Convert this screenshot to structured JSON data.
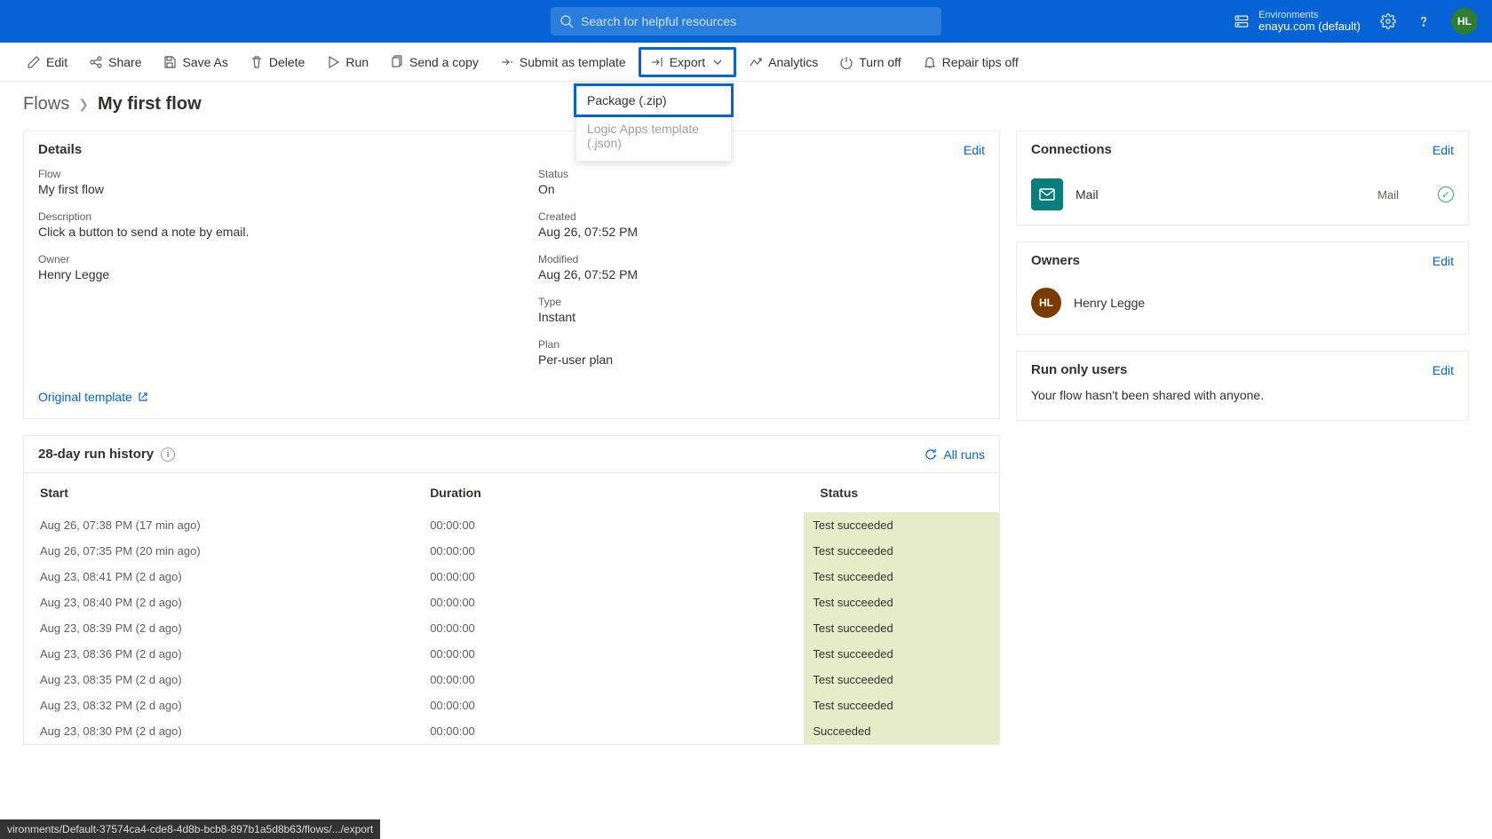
{
  "topbar": {
    "search_placeholder": "Search for helpful resources",
    "env_label": "Environments",
    "env_name": "enayu.com (default)",
    "avatar_initials": "HL"
  },
  "commandbar": {
    "edit": "Edit",
    "share": "Share",
    "save_as": "Save As",
    "delete": "Delete",
    "run": "Run",
    "send_copy": "Send a copy",
    "submit_template": "Submit as template",
    "export": "Export",
    "analytics": "Analytics",
    "turn_off": "Turn off",
    "repair_tips": "Repair tips off"
  },
  "export_menu": {
    "package": "Package (.zip)",
    "logic_apps": "Logic Apps template (.json)"
  },
  "breadcrumb": {
    "root": "Flows",
    "current": "My first flow"
  },
  "details": {
    "title": "Details",
    "edit": "Edit",
    "flow_label": "Flow",
    "flow_value": "My first flow",
    "description_label": "Description",
    "description_value": "Click a button to send a note by email.",
    "owner_label": "Owner",
    "owner_value": "Henry Legge",
    "status_label": "Status",
    "status_value": "On",
    "created_label": "Created",
    "created_value": "Aug 26, 07:52 PM",
    "modified_label": "Modified",
    "modified_value": "Aug 26, 07:52 PM",
    "type_label": "Type",
    "type_value": "Instant",
    "plan_label": "Plan",
    "plan_value": "Per-user plan",
    "template_link": "Original template"
  },
  "history": {
    "title": "28-day run history",
    "all_runs": "All runs",
    "col_start": "Start",
    "col_duration": "Duration",
    "col_status": "Status",
    "rows": [
      {
        "start": "Aug 26, 07:38 PM (17 min ago)",
        "duration": "00:00:00",
        "status": "Test succeeded"
      },
      {
        "start": "Aug 26, 07:35 PM (20 min ago)",
        "duration": "00:00:00",
        "status": "Test succeeded"
      },
      {
        "start": "Aug 23, 08:41 PM (2 d ago)",
        "duration": "00:00:00",
        "status": "Test succeeded"
      },
      {
        "start": "Aug 23, 08:40 PM (2 d ago)",
        "duration": "00:00:00",
        "status": "Test succeeded"
      },
      {
        "start": "Aug 23, 08:39 PM (2 d ago)",
        "duration": "00:00:00",
        "status": "Test succeeded"
      },
      {
        "start": "Aug 23, 08:36 PM (2 d ago)",
        "duration": "00:00:00",
        "status": "Test succeeded"
      },
      {
        "start": "Aug 23, 08:35 PM (2 d ago)",
        "duration": "00:00:00",
        "status": "Test succeeded"
      },
      {
        "start": "Aug 23, 08:32 PM (2 d ago)",
        "duration": "00:00:00",
        "status": "Test succeeded"
      },
      {
        "start": "Aug 23, 08:30 PM (2 d ago)",
        "duration": "00:00:00",
        "status": "Succeeded"
      }
    ]
  },
  "connections": {
    "title": "Connections",
    "edit": "Edit",
    "name": "Mail",
    "sub": "Mail"
  },
  "owners": {
    "title": "Owners",
    "edit": "Edit",
    "initials": "HL",
    "name": "Henry Legge"
  },
  "run_only_users": {
    "title": "Run only users",
    "edit": "Edit",
    "body": "Your flow hasn't been shared with anyone."
  },
  "footer_url": "vironments/Default-37574ca4-cde8-4d8b-bcb8-897b1a5d8b63/flows/.../export"
}
